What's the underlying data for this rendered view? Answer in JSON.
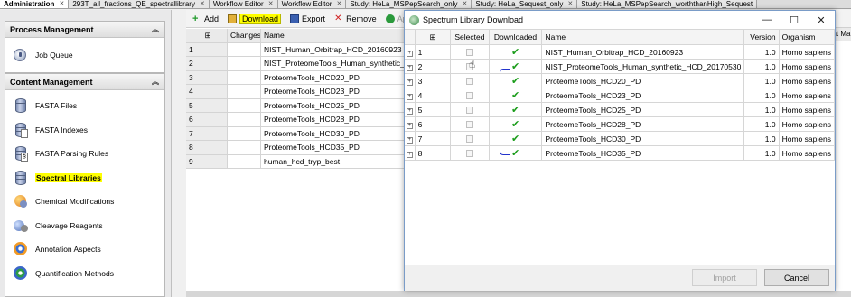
{
  "tabs": [
    {
      "label": "Administration",
      "active": true
    },
    {
      "label": "293T_all_fractions_QE_spectrallibrary",
      "active": false
    },
    {
      "label": "Workflow Editor",
      "active": false
    },
    {
      "label": "Workflow Editor",
      "active": false
    },
    {
      "label": "Study: HeLa_MSPepSearch_only",
      "active": false
    },
    {
      "label": "Study: HeLa_Sequest_only",
      "active": false
    },
    {
      "label": "Study: HeLa_MSPepSearch_worththanHigh_Sequest",
      "active": false
    }
  ],
  "sidebar": {
    "process": {
      "title": "Process Management",
      "items": [
        {
          "label": "Job Queue",
          "icon": "job-queue-icon"
        }
      ]
    },
    "content": {
      "title": "Content Management",
      "items": [
        {
          "label": "FASTA Files",
          "icon": "database-icon"
        },
        {
          "label": "FASTA Indexes",
          "icon": "database-index-icon"
        },
        {
          "label": "FASTA Parsing Rules",
          "icon": "parsing-rules-icon"
        },
        {
          "label": "Spectral Libraries",
          "icon": "spectral-library-icon",
          "selected": true
        },
        {
          "label": "Chemical Modifications",
          "icon": "chemical-modifications-icon"
        },
        {
          "label": "Cleavage Reagents",
          "icon": "cleavage-reagents-icon"
        },
        {
          "label": "Annotation Aspects",
          "icon": "annotation-aspects-icon"
        },
        {
          "label": "Quantification Methods",
          "icon": "quantification-methods-icon"
        }
      ]
    }
  },
  "toolbar": {
    "add": "Add",
    "download": "Download",
    "export": "Export",
    "remove": "Remove",
    "apply": "App"
  },
  "background_grid": {
    "headers": {
      "changes": "Changes",
      "name": "Name"
    },
    "rows": [
      {
        "num": "1",
        "name": "NIST_Human_Orbitrap_HCD_20160923"
      },
      {
        "num": "2",
        "name": "NIST_ProteomeTools_Human_synthetic_H"
      },
      {
        "num": "3",
        "name": "ProteomeTools_HCD20_PD"
      },
      {
        "num": "4",
        "name": "ProteomeTools_HCD23_PD"
      },
      {
        "num": "5",
        "name": "ProteomeTools_HCD25_PD"
      },
      {
        "num": "6",
        "name": "ProteomeTools_HCD28_PD"
      },
      {
        "num": "7",
        "name": "ProteomeTools_HCD30_PD"
      },
      {
        "num": "8",
        "name": "ProteomeTools_HCD35_PD"
      },
      {
        "num": "9",
        "name": "human_hcd_tryp_best"
      }
    ],
    "right_header": "ent Ma"
  },
  "dialog": {
    "title": "Spectrum Library Download",
    "columns": {
      "selected": "Selected",
      "downloaded": "Downloaded",
      "name": "Name",
      "version": "Version",
      "organism": "Organism"
    },
    "rows": [
      {
        "num": "1",
        "downloaded": true,
        "name": "NIST_Human_Orbitrap_HCD_20160923",
        "version": "1.0",
        "organism": "Homo sapiens"
      },
      {
        "num": "2",
        "downloaded": true,
        "name": "NIST_ProteomeTools_Human_synthetic_HCD_20170530",
        "version": "1.0",
        "organism": "Homo sapiens"
      },
      {
        "num": "3",
        "downloaded": true,
        "name": "ProteomeTools_HCD20_PD",
        "version": "1.0",
        "organism": "Homo sapiens"
      },
      {
        "num": "4",
        "downloaded": true,
        "name": "ProteomeTools_HCD23_PD",
        "version": "1.0",
        "organism": "Homo sapiens"
      },
      {
        "num": "5",
        "downloaded": true,
        "name": "ProteomeTools_HCD25_PD",
        "version": "1.0",
        "organism": "Homo sapiens"
      },
      {
        "num": "6",
        "downloaded": true,
        "name": "ProteomeTools_HCD28_PD",
        "version": "1.0",
        "organism": "Homo sapiens"
      },
      {
        "num": "7",
        "downloaded": true,
        "name": "ProteomeTools_HCD30_PD",
        "version": "1.0",
        "organism": "Homo sapiens"
      },
      {
        "num": "8",
        "downloaded": true,
        "name": "ProteomeTools_HCD35_PD",
        "version": "1.0",
        "organism": "Homo sapiens"
      }
    ],
    "import_button": "Import",
    "cancel_button": "Cancel"
  },
  "colors": {
    "highlight": "#ffff00",
    "check": "#1a9c1a",
    "annotation_bracket": "#2233cc"
  }
}
